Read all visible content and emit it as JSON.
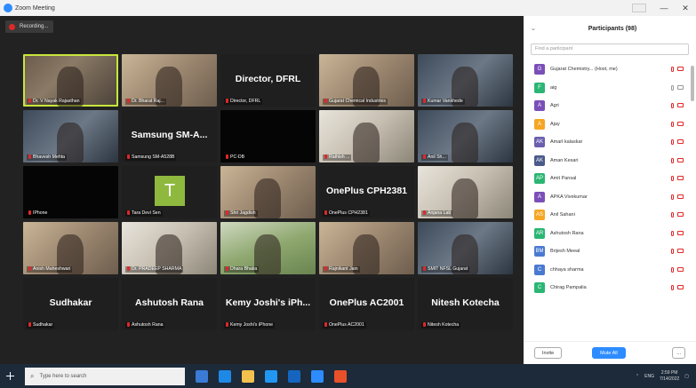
{
  "window": {
    "title": "Zoom Meeting",
    "controls": [
      "—",
      "✕"
    ]
  },
  "recording": {
    "label": "Recording..."
  },
  "tiles": [
    {
      "kind": "video",
      "style": "t-vid t-active",
      "name": "Dr. V Nayak Rajasthan"
    },
    {
      "kind": "video",
      "style": "t-vid2",
      "name": "Dr. Bharat Raj..."
    },
    {
      "kind": "text",
      "big": "Director, DFRL",
      "name": "Director, DFRL"
    },
    {
      "kind": "video",
      "style": "t-vid2",
      "name": "Gujarat Chemical Industries"
    },
    {
      "kind": "video",
      "style": "t-vid3",
      "name": "Kumar Vankhede"
    },
    {
      "kind": "video",
      "style": "t-vid3",
      "name": "Bhavesh Mehta"
    },
    {
      "kind": "text",
      "big": "Samsung SM-A...",
      "name": "Samsung SM-A528B"
    },
    {
      "kind": "black",
      "name": "PC-DB"
    },
    {
      "kind": "video",
      "style": "t-vid4",
      "name": "Rathish ..."
    },
    {
      "kind": "video",
      "style": "t-vid3",
      "name": "Anil Sh..."
    },
    {
      "kind": "black",
      "name": "IPhone"
    },
    {
      "kind": "avatar",
      "letter": "T",
      "name": "Tara Devi Sen"
    },
    {
      "kind": "video",
      "style": "t-vid2",
      "name": "Shri Jagdish"
    },
    {
      "kind": "text",
      "big": "OnePlus CPH2381",
      "name": "OnePlus CPH2381"
    },
    {
      "kind": "video",
      "style": "t-vid4",
      "name": "Anjana Lab"
    },
    {
      "kind": "video",
      "style": "t-vid2",
      "name": "Anish Maheshwari"
    },
    {
      "kind": "video",
      "style": "t-vid4",
      "name": "Dr. PRADEEP SHARMA"
    },
    {
      "kind": "video",
      "style": "t-vid5",
      "name": "Dhara Bhatia"
    },
    {
      "kind": "video",
      "style": "t-vid2",
      "name": "Rajnikant Jain"
    },
    {
      "kind": "video",
      "style": "t-vid3",
      "name": "SMIT NFSL Gujarat"
    },
    {
      "kind": "text",
      "big": "Sudhakar",
      "name": "Sudhakar"
    },
    {
      "kind": "text",
      "big": "Ashutosh Rana",
      "name": "Ashutosh Rana"
    },
    {
      "kind": "text",
      "big": "Kemy Joshi's iPh...",
      "name": "Kemy Joshi's iPhone"
    },
    {
      "kind": "text",
      "big": "OnePlus AC2001",
      "name": "OnePlus AC2001"
    },
    {
      "kind": "text",
      "big": "Nitesh Kotecha",
      "name": "Nitesh Kotecha"
    }
  ],
  "panel": {
    "title": "Participants (98)",
    "search_placeholder": "Find a participant",
    "participants": [
      {
        "initial": "G",
        "color": "#7b4fb8",
        "name": "Gujarat Chemistry... (Host, me)",
        "icons": "both"
      },
      {
        "initial": "F",
        "color": "#2bb673",
        "name": "aig",
        "icons": "gray"
      },
      {
        "initial": "A",
        "color": "#7b4fb8",
        "name": "Agri",
        "icons": "both"
      },
      {
        "initial": "A",
        "color": "#f5a623",
        "name": "Ajay",
        "icons": "both"
      },
      {
        "initial": "AK",
        "color": "#6b5fb0",
        "name": "Amarl kalaskar",
        "icons": "both"
      },
      {
        "initial": "AK",
        "color": "#4a5a8a",
        "name": "Aman Kesari",
        "icons": "both"
      },
      {
        "initial": "AP",
        "color": "#2bb673",
        "name": "Amit Pansal",
        "icons": "both"
      },
      {
        "initial": "A",
        "color": "#7b4fb8",
        "name": "APKA Vivekumar",
        "icons": "both"
      },
      {
        "initial": "AS",
        "color": "#f5a623",
        "name": "Anil Sahani",
        "icons": "both"
      },
      {
        "initial": "AR",
        "color": "#2bb673",
        "name": "Ashutosh Rana",
        "icons": "both"
      },
      {
        "initial": "BM",
        "color": "#4a7ad0",
        "name": "Brijesh Meeal",
        "icons": "both"
      },
      {
        "initial": "C",
        "color": "#4a7ad0",
        "name": "chhaya sharma",
        "icons": "both"
      },
      {
        "initial": "C",
        "color": "#2bb673",
        "name": "Chirag Pampalia",
        "icons": "both"
      }
    ],
    "footer": {
      "invite": "Invite",
      "mute_all": "Mute All",
      "more": "..."
    }
  },
  "taskbar": {
    "search_text": "Type here to search",
    "time": "2:59 PM",
    "date": "7/14/2022",
    "lang": "ENG"
  }
}
